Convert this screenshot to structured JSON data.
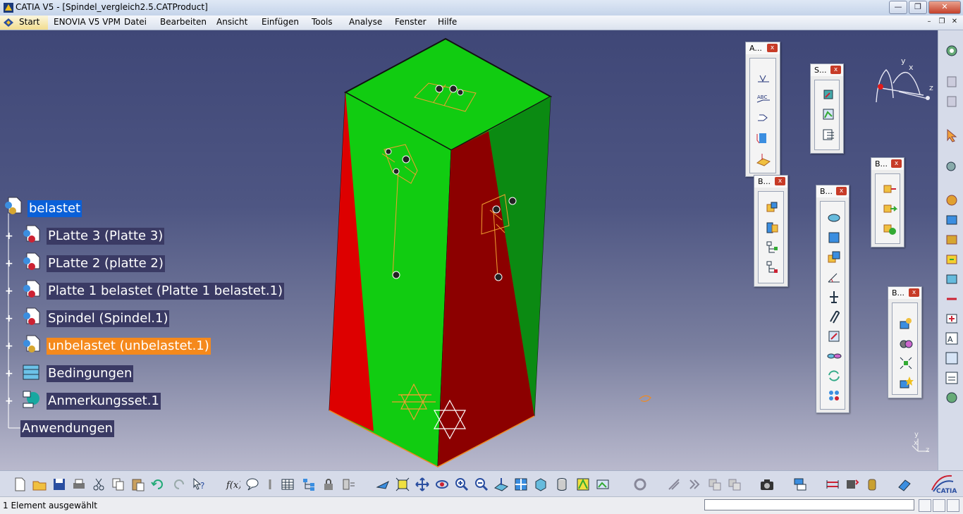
{
  "window": {
    "title": "CATIA V5 - [Spindel_vergleich2.5.CATProduct]",
    "controls": {
      "minimize": "—",
      "maximize": "❐",
      "close": "✕"
    }
  },
  "menubar": {
    "start": "Start",
    "items": [
      "ENOVIA V5 VPM",
      "Datei",
      "Bearbeiten",
      "Ansicht",
      "Einfügen",
      "Tools",
      "Analyse",
      "Fenster",
      "Hilfe"
    ],
    "doc_controls": {
      "minimize": "–",
      "restore": "❐",
      "close": "✕"
    }
  },
  "tree": {
    "root": "belastet",
    "items": [
      {
        "label": "PLatte 3 (Platte 3)",
        "icon": "part-icon",
        "expandable": true
      },
      {
        "label": "PLatte 2 (platte 2)",
        "icon": "part-icon",
        "expandable": true
      },
      {
        "label": "Platte 1 belastet (Platte 1 belastet.1)",
        "icon": "part-icon",
        "expandable": true
      },
      {
        "label": "Spindel (Spindel.1)",
        "icon": "part-icon",
        "expandable": true
      },
      {
        "label": "unbelastet (unbelastet.1)",
        "icon": "part-icon",
        "expandable": true,
        "highlighted": true
      },
      {
        "label": "Bedingungen",
        "icon": "constraints-icon",
        "expandable": true
      },
      {
        "label": "Anmerkungsset.1",
        "icon": "annotation-set-icon",
        "expandable": true
      }
    ],
    "last": "Anwendungen"
  },
  "floating_toolbars": [
    {
      "title": "A...",
      "close": "x"
    },
    {
      "title": "S...",
      "close": "x"
    },
    {
      "title": "B...",
      "close": "x"
    },
    {
      "title": "B...",
      "close": "x"
    },
    {
      "title": "B...",
      "close": "x"
    },
    {
      "title": "B...",
      "close": "x"
    }
  ],
  "compass": {
    "x": "x",
    "y": "y",
    "z": "z"
  },
  "axis_indicator": {
    "x": "x",
    "y": "y",
    "z": "z"
  },
  "status": {
    "message": "1 Element ausgewählt",
    "command_placeholder": ""
  },
  "colors": {
    "viewport_top": "#3f4777",
    "viewport_bottom": "#b9b9cd",
    "face_green": "#11cc11",
    "face_red": "#dd0000",
    "selection_blue": "#0a60d8",
    "highlight_orange": "#f5891c"
  }
}
